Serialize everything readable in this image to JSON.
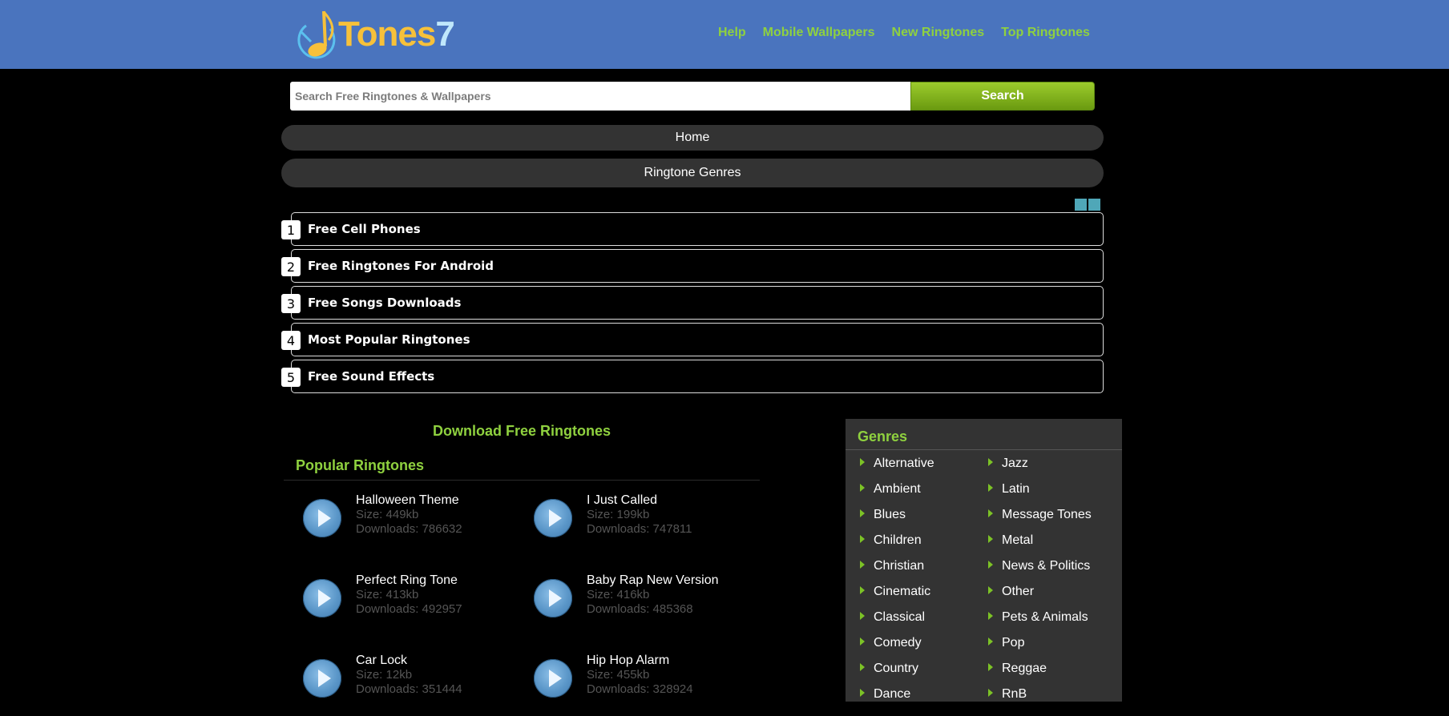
{
  "header": {
    "logo": {
      "main": "Tones",
      "accent": "7"
    },
    "nav": [
      "Help",
      "Mobile Wallpapers",
      "New Ringtones",
      "Top Ringtones"
    ]
  },
  "search": {
    "placeholder": "Search Free Ringtones & Wallpapers",
    "value": "",
    "button": "Search"
  },
  "pills": {
    "home": "Home",
    "genres": "Ringtone Genres"
  },
  "links": [
    {
      "num": "1",
      "label": "Free Cell Phones"
    },
    {
      "num": "2",
      "label": "Free Ringtones For Android"
    },
    {
      "num": "3",
      "label": "Free Songs Downloads"
    },
    {
      "num": "4",
      "label": "Most Popular Ringtones"
    },
    {
      "num": "5",
      "label": "Free Sound Effects"
    }
  ],
  "main": {
    "download_title": "Download Free Ringtones",
    "popular_title": "Popular Ringtones",
    "ringtones": [
      {
        "name": "Halloween Theme",
        "size": "Size: 449kb",
        "downloads": "Downloads: 786632"
      },
      {
        "name": "I Just Called",
        "size": "Size: 199kb",
        "downloads": "Downloads: 747811"
      },
      {
        "name": "Perfect Ring Tone",
        "size": "Size: 413kb",
        "downloads": "Downloads: 492957"
      },
      {
        "name": "Baby Rap New Version",
        "size": "Size: 416kb",
        "downloads": "Downloads: 485368"
      },
      {
        "name": "Car Lock",
        "size": "Size: 12kb",
        "downloads": "Downloads: 351444"
      },
      {
        "name": "Hip Hop Alarm",
        "size": "Size: 455kb",
        "downloads": "Downloads: 328924"
      }
    ]
  },
  "genres": {
    "title": "Genres",
    "left": [
      "Alternative",
      "Ambient",
      "Blues",
      "Children",
      "Christian",
      "Cinematic",
      "Classical",
      "Comedy",
      "Country",
      "Dance"
    ],
    "right": [
      "Jazz",
      "Latin",
      "Message Tones",
      "Metal",
      "News & Politics",
      "Other",
      "Pets & Animals",
      "Pop",
      "Reggae",
      "RnB"
    ]
  },
  "colors": {
    "header_bg": "#4a74be",
    "accent_green": "#8fd13f",
    "panel_bg": "#333333"
  }
}
